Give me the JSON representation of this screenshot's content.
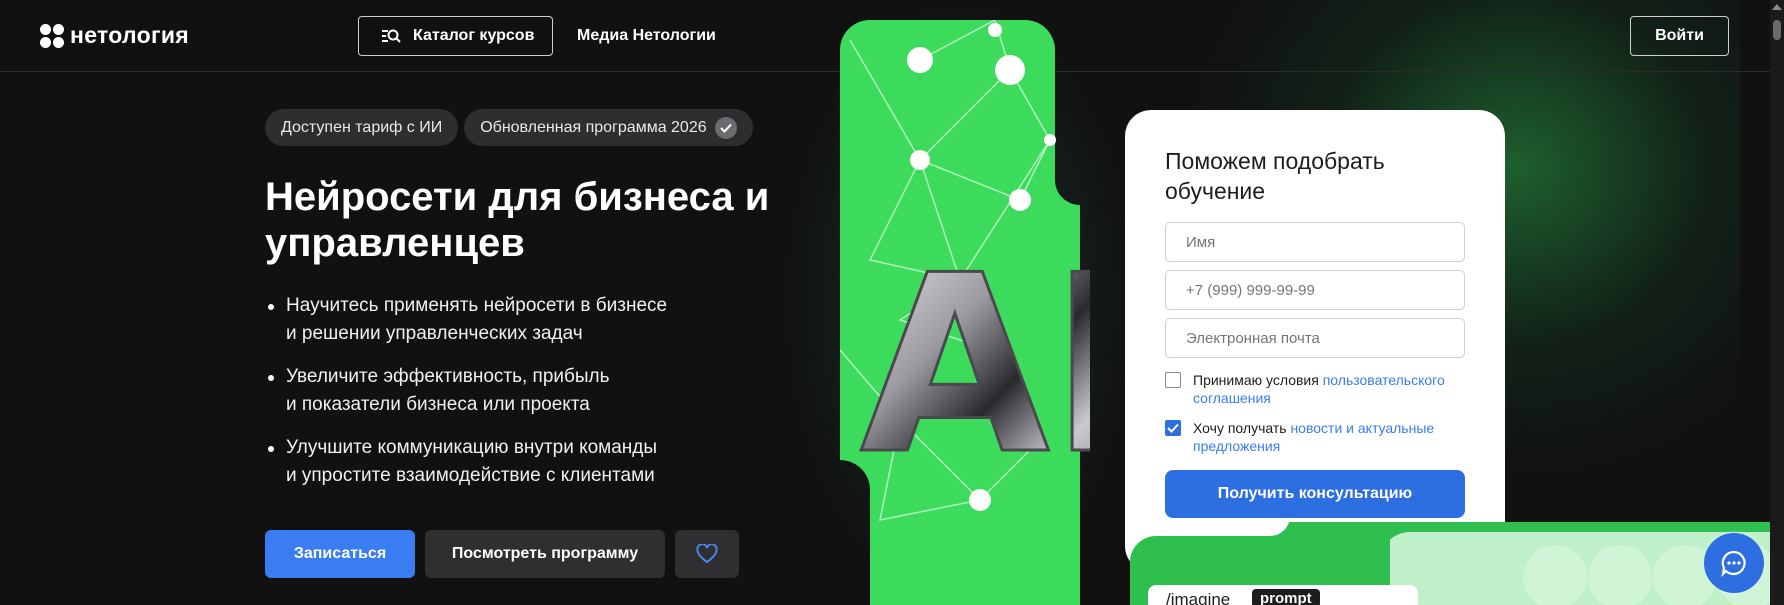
{
  "header": {
    "logo_text": "нетология",
    "catalog_label": "Каталог курсов",
    "media_label": "Медиа Нетологии",
    "login_label": "Войти"
  },
  "badges": [
    {
      "label": "Доступен тариф с ИИ"
    },
    {
      "label": "Обновленная программа 2026"
    }
  ],
  "hero": {
    "title": "Нейросети для бизнеса и управленцев",
    "bullets": [
      "Научитесь применять нейросети в бизнесе\nи решении управленческих задач",
      "Увеличите эффективность, прибыль\nи показатели бизнеса или проекта",
      "Улучшите коммуникацию внутри команды\nи упростите взаимодействие с клиентами"
    ],
    "enroll_label": "Записаться",
    "program_label": "Посмотреть программу"
  },
  "visual": {
    "ai_text": "AI"
  },
  "form": {
    "title": "Поможем подобрать обучение",
    "name_placeholder": "Имя",
    "phone_placeholder": "+7 (999) 999-99-99",
    "email_placeholder": "Электронная почта",
    "terms_text": "Принимаю условия ",
    "terms_link": "пользовательского соглашения",
    "terms_checked": false,
    "news_text": "Хочу получать ",
    "news_link": "новости и актуальные предложения",
    "news_checked": true,
    "submit_label": "Получить консультацию"
  },
  "promo": {
    "imagine_text": "/imagine",
    "prompt_chip": "prompt"
  },
  "colors": {
    "background": "#111112",
    "accent_green": "#3ddb5c",
    "primary_blue": "#2d6fe0"
  }
}
